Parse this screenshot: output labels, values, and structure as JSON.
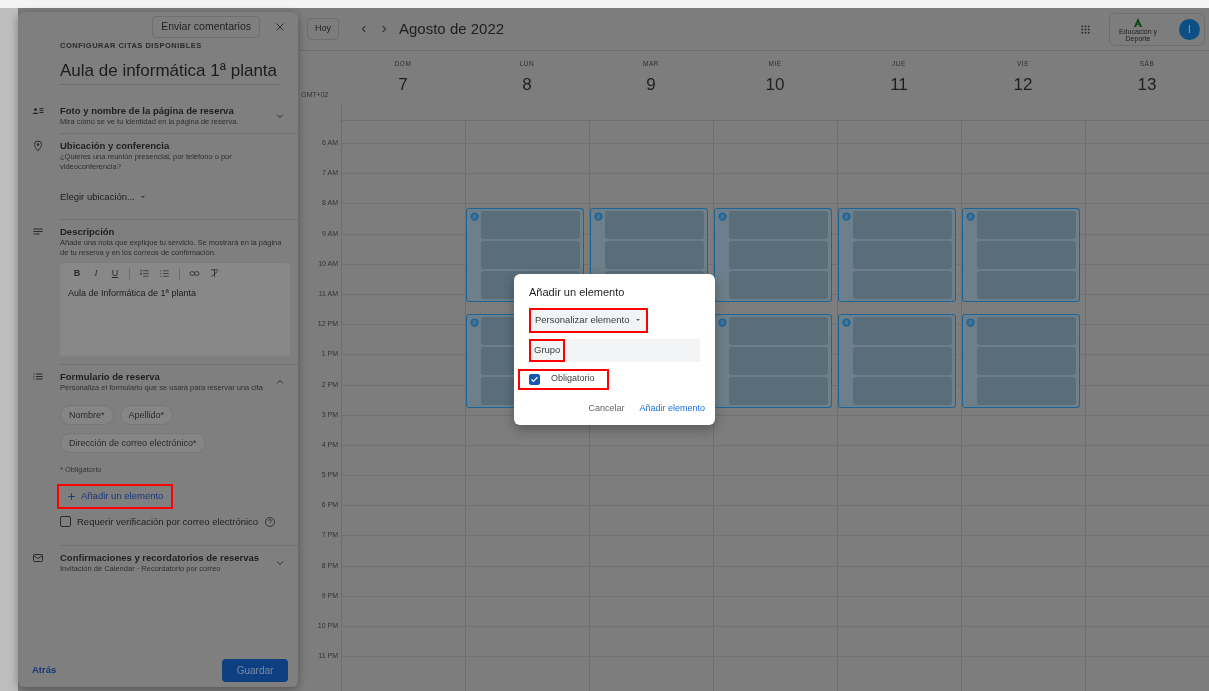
{
  "panel": {
    "feedback_button": "Enviar comentarios",
    "header_label": "CONFIGURAR CITAS DISPONIBLES",
    "title": "Aula de informática 1ª planta",
    "sections": [
      {
        "kind": "identity",
        "title": "Foto y nombre de la página de reserva",
        "subtitle": "Mira cómo se ve tu identidad en la página de reserva.",
        "expanded": false
      },
      {
        "kind": "location",
        "title": "Ubicación y conferencia",
        "subtitle": "¿Quieres una reunión presencial, por teléfono o por videoconferencia?",
        "dropdown": "Elegir ubicación..."
      },
      {
        "kind": "description",
        "title": "Descripción",
        "subtitle": "Añade una nota que explique tu servicio. Se mostrará en la página de tu reserva y en los correos de confirmación.",
        "toolbar": [
          "B",
          "I",
          "U"
        ],
        "text": "Aula de Informática de 1ª planta"
      },
      {
        "kind": "form",
        "title": "Formulario de reserva",
        "subtitle": "Personaliza el formulario que se usará para reservar una cita",
        "expanded": true,
        "chips": [
          "Nombre*",
          "Apellido*",
          "Dirección de correo electrónico*"
        ],
        "note": "* Obligatorio",
        "add_button": {
          "label": "Añadir un elemento",
          "highlighted": true
        },
        "checkbox": {
          "label": "Requerir verificación por correo electrónico",
          "checked": false
        }
      },
      {
        "kind": "notifications",
        "title": "Confirmaciones y recordatorios de reservas",
        "subtitle": "Invitación de Calendar · Recordatorio por correo",
        "expanded": false
      }
    ],
    "back_link": "Atrás",
    "save_button": "Guardar"
  },
  "calendar": {
    "today_button": "Hoy",
    "title": "Agosto de 2022",
    "logo_text": "Educación y Deporte",
    "avatar": "I",
    "timezone": "GMT+02",
    "days": [
      {
        "weekday": "DOM",
        "date": "7",
        "morning_block": false,
        "midday_block": false
      },
      {
        "weekday": "LUN",
        "date": "8",
        "morning_block": true,
        "midday_block": true
      },
      {
        "weekday": "MAR",
        "date": "9",
        "morning_block": true,
        "midday_block": false
      },
      {
        "weekday": "MIÉ",
        "date": "10",
        "morning_block": true,
        "midday_block": true
      },
      {
        "weekday": "JUE",
        "date": "11",
        "morning_block": true,
        "midday_block": true
      },
      {
        "weekday": "VIE",
        "date": "12",
        "morning_block": true,
        "midday_block": true
      },
      {
        "weekday": "SÁB",
        "date": "13",
        "morning_block": false,
        "midday_block": false
      }
    ],
    "hours": [
      "6 AM",
      "7 AM",
      "8 AM",
      "9 AM",
      "10 AM",
      "11 AM",
      "12 PM",
      "1 PM",
      "2 PM",
      "3 PM",
      "4 PM",
      "5 PM",
      "6 PM",
      "7 PM",
      "8 PM",
      "9 PM",
      "10 PM",
      "11 PM"
    ]
  },
  "dialog": {
    "title": "Añadir un elemento",
    "dropdown": {
      "label": "Personalizar elemento",
      "highlighted": true
    },
    "field": {
      "value": "Grupo",
      "highlighted": true
    },
    "checkbox": {
      "label": "Obligatorio",
      "checked": true,
      "highlighted": true
    },
    "buttons": [
      "Cancelar",
      "Añadir elemento"
    ]
  }
}
